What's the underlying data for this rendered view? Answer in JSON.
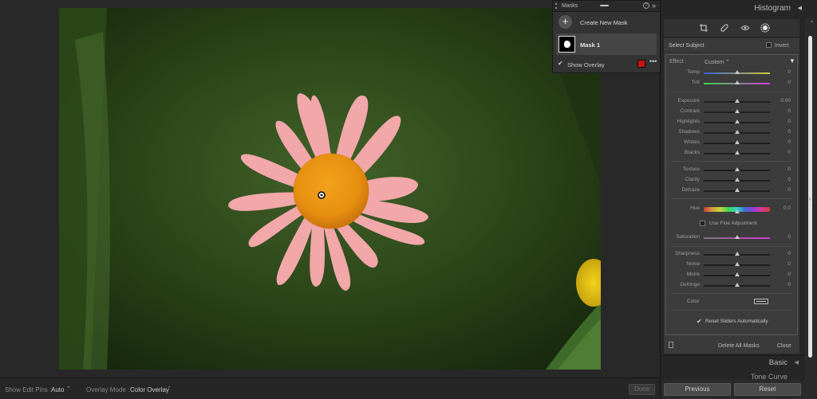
{
  "masks_panel": {
    "title": "Masks",
    "help": "?",
    "collapse": "»",
    "create_plus": "+",
    "create_label": "Create New Mask",
    "mask_name": "Mask 1",
    "show_overlay_label": "Show Overlay",
    "show_overlay_checked": true,
    "overlay_color": "#cc1111",
    "more": "•••"
  },
  "bottom_bar": {
    "edit_pins_label": "Show Edit Pins :",
    "edit_pins_value": "Auto",
    "overlay_mode_label": "Overlay Mode :",
    "overlay_mode_value": "Color Overlay",
    "caret": "⌃",
    "done_label": "Done"
  },
  "right_panel": {
    "histogram_title": "Histogram",
    "tri_left": "◀",
    "select_subject_label": "Select Subject",
    "invert_label": "Invert",
    "effect_label": "Effect :",
    "effect_value": "Custom ⌃",
    "effect_toggle": "▼",
    "sliders_group1": [
      {
        "name": "Temp",
        "value": "0",
        "pos": 0.5
      },
      {
        "name": "Tint",
        "value": "0",
        "pos": 0.5
      }
    ],
    "sliders_group2": [
      {
        "name": "Exposure",
        "value": "0.00",
        "pos": 0.5
      },
      {
        "name": "Contrast",
        "value": "0",
        "pos": 0.5
      },
      {
        "name": "Highlights",
        "value": "0",
        "pos": 0.5
      },
      {
        "name": "Shadows",
        "value": "0",
        "pos": 0.5
      },
      {
        "name": "Whites",
        "value": "0",
        "pos": 0.5
      },
      {
        "name": "Blacks",
        "value": "0",
        "pos": 0.5
      }
    ],
    "sliders_group3": [
      {
        "name": "Texture",
        "value": "0",
        "pos": 0.5
      },
      {
        "name": "Clarity",
        "value": "0",
        "pos": 0.5
      },
      {
        "name": "Dehaze",
        "value": "0",
        "pos": 0.5
      }
    ],
    "hue": {
      "name": "Hue",
      "value": "0.0",
      "pos": 0.5
    },
    "fine_adjust_label": "Use Fine Adjustment",
    "saturation": {
      "name": "Saturation",
      "value": "0",
      "pos": 0.5
    },
    "sliders_group4": [
      {
        "name": "Sharpness",
        "value": "0",
        "pos": 0.5
      },
      {
        "name": "Noise",
        "value": "0",
        "pos": 0.5
      },
      {
        "name": "Moire",
        "value": "0",
        "pos": 0.5
      },
      {
        "name": "Defringe",
        "value": "0",
        "pos": 0.5
      }
    ],
    "color_label": "Color",
    "reset_sliders_label": "Reset Sliders Automatically",
    "reset_sliders_checked": true,
    "delete_all_label": "Delete All Masks",
    "close_label": "Close",
    "basic_title": "Basic",
    "tone_curve_title": "Tone Curve",
    "previous_label": "Previous",
    "reset_label": "Reset"
  },
  "icons": {
    "crop": "crop-icon",
    "heal": "bandage-icon",
    "redeye": "eye-icon",
    "masking": "masking-icon"
  }
}
